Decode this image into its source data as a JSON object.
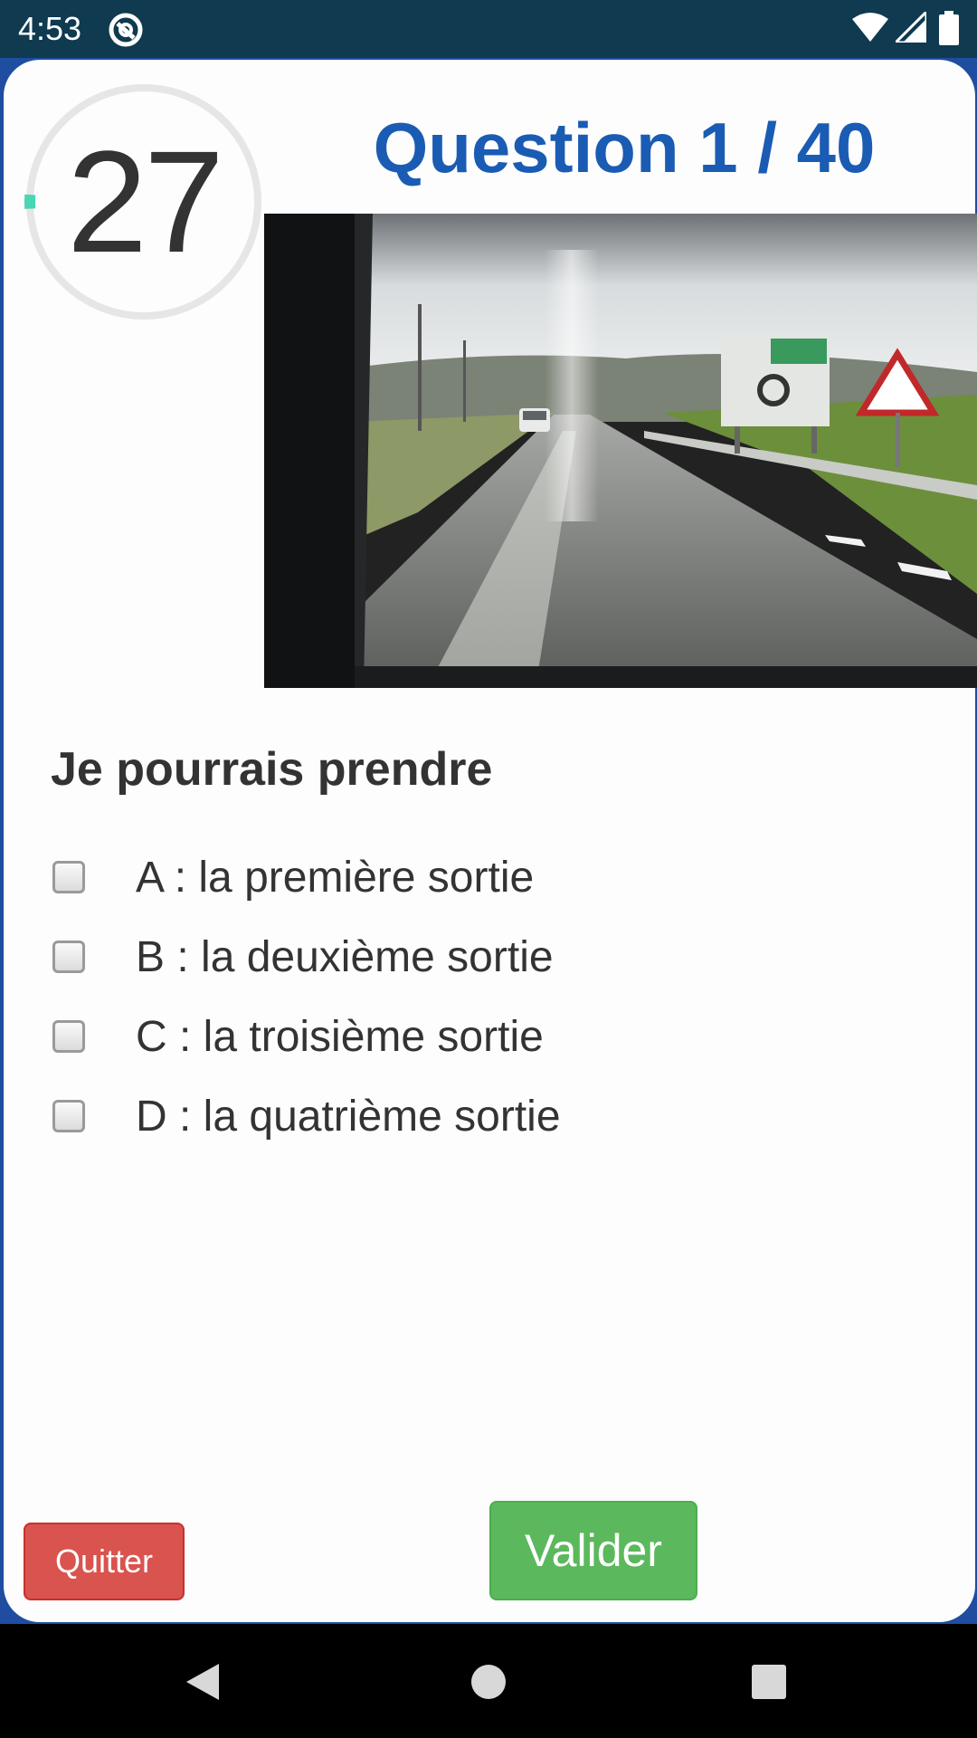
{
  "status_bar": {
    "time": "4:53",
    "icons": [
      "sync-icon",
      "wifi-icon",
      "signal-icon",
      "battery-icon"
    ]
  },
  "timer": {
    "value": "27",
    "progress_fraction": 0.02,
    "ring_color": "#e6e6e6",
    "progress_color": "#48d6b4"
  },
  "question": {
    "title": "Question 1 / 40",
    "title_color": "#1a5cb4",
    "prompt": "Je pourrais prendre",
    "options": [
      {
        "label": "A : la première sortie",
        "checked": false
      },
      {
        "label": "B : la deuxième sortie",
        "checked": false
      },
      {
        "label": "C : la troisième sortie",
        "checked": false
      },
      {
        "label": "D : la quatrième sortie",
        "checked": false
      }
    ]
  },
  "buttons": {
    "quit_label": "Quitter",
    "quit_color": "#d9534f",
    "submit_label": "Valider",
    "submit_color": "#5cb85c"
  },
  "nav_bar": {
    "icons": [
      "back-icon",
      "home-icon",
      "recents-icon"
    ]
  }
}
